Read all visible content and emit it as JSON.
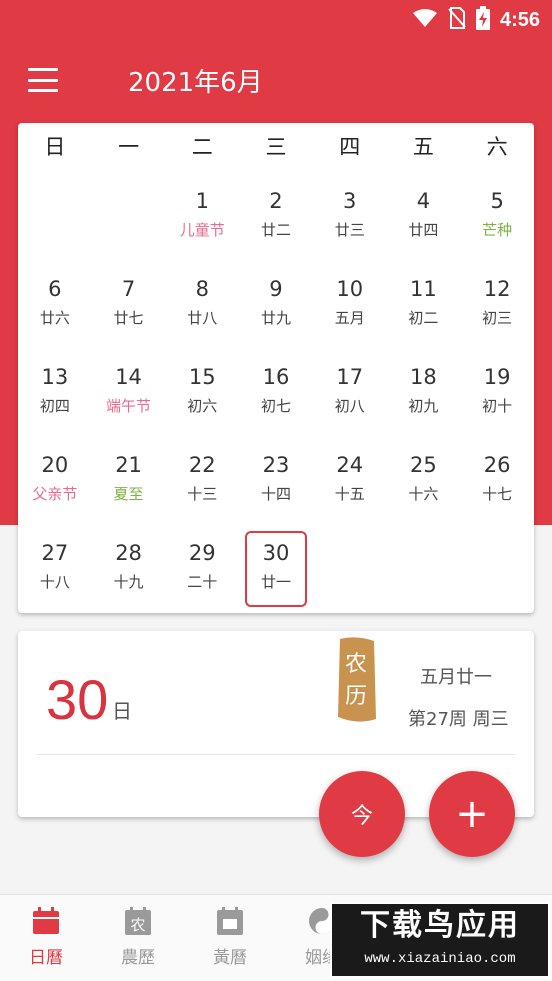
{
  "status_bar": {
    "time": "4:56",
    "icons": [
      "wifi-icon",
      "no-sim-icon",
      "battery-charging-icon"
    ]
  },
  "header": {
    "month_title": "2021年6月",
    "menu_icon": "hamburger-menu-icon"
  },
  "colors": {
    "accent": "#e03a45",
    "holiday_pink": "#e86b8f",
    "solar_term_green": "#7cb342"
  },
  "calendar": {
    "weekdays": [
      "日",
      "一",
      "二",
      "三",
      "四",
      "五",
      "六"
    ],
    "selected_day": "30",
    "days": [
      {
        "day": "",
        "lunar": ""
      },
      {
        "day": "",
        "lunar": ""
      },
      {
        "day": "1",
        "lunar": "儿童节",
        "type": "holiday"
      },
      {
        "day": "2",
        "lunar": "廿二"
      },
      {
        "day": "3",
        "lunar": "廿三"
      },
      {
        "day": "4",
        "lunar": "廿四"
      },
      {
        "day": "5",
        "lunar": "芒种",
        "type": "term"
      },
      {
        "day": "6",
        "lunar": "廿六"
      },
      {
        "day": "7",
        "lunar": "廿七"
      },
      {
        "day": "8",
        "lunar": "廿八"
      },
      {
        "day": "9",
        "lunar": "廿九"
      },
      {
        "day": "10",
        "lunar": "五月"
      },
      {
        "day": "11",
        "lunar": "初二"
      },
      {
        "day": "12",
        "lunar": "初三"
      },
      {
        "day": "13",
        "lunar": "初四"
      },
      {
        "day": "14",
        "lunar": "端午节",
        "type": "holiday"
      },
      {
        "day": "15",
        "lunar": "初六"
      },
      {
        "day": "16",
        "lunar": "初七"
      },
      {
        "day": "17",
        "lunar": "初八"
      },
      {
        "day": "18",
        "lunar": "初九"
      },
      {
        "day": "19",
        "lunar": "初十"
      },
      {
        "day": "20",
        "lunar": "父亲节",
        "type": "holiday"
      },
      {
        "day": "21",
        "lunar": "夏至",
        "type": "term"
      },
      {
        "day": "22",
        "lunar": "十三"
      },
      {
        "day": "23",
        "lunar": "十四"
      },
      {
        "day": "24",
        "lunar": "十五"
      },
      {
        "day": "25",
        "lunar": "十六"
      },
      {
        "day": "26",
        "lunar": "十七"
      },
      {
        "day": "27",
        "lunar": "十八"
      },
      {
        "day": "28",
        "lunar": "十九"
      },
      {
        "day": "29",
        "lunar": "二十"
      },
      {
        "day": "30",
        "lunar": "廿一",
        "selected": true
      }
    ]
  },
  "day_info": {
    "day_number": "30",
    "day_unit": "日",
    "seal_text": [
      "农",
      "历"
    ],
    "lunar_date": "五月廿一",
    "week_info": "第27周 周三"
  },
  "fabs": {
    "today_label": "今",
    "add_label": "+"
  },
  "bottom_nav": [
    {
      "label": "日曆",
      "icon": "calendar-icon",
      "active": true
    },
    {
      "label": "農歷",
      "icon": "lunar-calendar-icon",
      "active": false
    },
    {
      "label": "黃曆",
      "icon": "almanac-icon",
      "active": false
    },
    {
      "label": "姻缘",
      "icon": "yin-yang-icon",
      "active": false
    }
  ],
  "watermark": {
    "main": "下载鸟应用",
    "sub": "www.xiazainiao.com"
  }
}
